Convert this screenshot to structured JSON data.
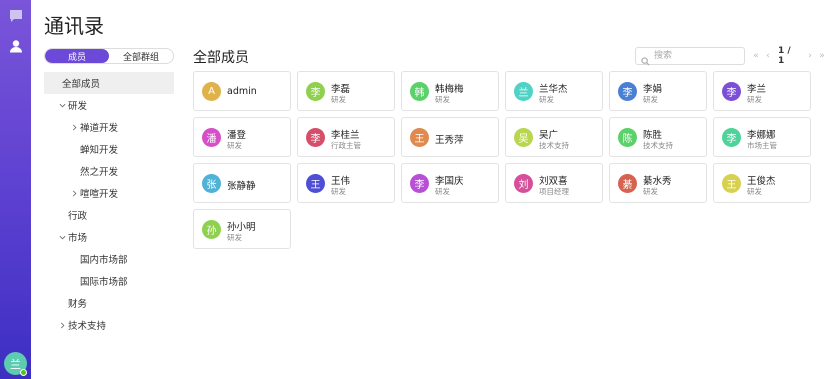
{
  "page": {
    "title": "通讯录"
  },
  "tabs": [
    {
      "label": "成员",
      "active": true
    },
    {
      "label": "全部群组",
      "active": false
    }
  ],
  "tree": [
    {
      "label": "全部成员",
      "level": 0,
      "caret": "none",
      "selected": true
    },
    {
      "label": "研发",
      "level": 1,
      "caret": "down",
      "selected": false
    },
    {
      "label": "禅道开发",
      "level": 2,
      "caret": "right",
      "selected": false
    },
    {
      "label": "蝉知开发",
      "level": 2,
      "caret": "none",
      "selected": false
    },
    {
      "label": "然之开发",
      "level": 2,
      "caret": "none",
      "selected": false
    },
    {
      "label": "喧喧开发",
      "level": 2,
      "caret": "right",
      "selected": false
    },
    {
      "label": "行政",
      "level": 1,
      "caret": "none",
      "selected": false
    },
    {
      "label": "市场",
      "level": 1,
      "caret": "down",
      "selected": false
    },
    {
      "label": "国内市场部",
      "level": 2,
      "caret": "none",
      "selected": false
    },
    {
      "label": "国际市场部",
      "level": 2,
      "caret": "none",
      "selected": false
    },
    {
      "label": "财务",
      "level": 1,
      "caret": "none",
      "selected": false
    },
    {
      "label": "技术支持",
      "level": 1,
      "caret": "right",
      "selected": false
    }
  ],
  "main": {
    "title": "全部成员",
    "search": {
      "placeholder": "搜索",
      "value": ""
    },
    "pager": {
      "text": "1 / 1"
    }
  },
  "members": [
    {
      "avatar": "A",
      "name": "admin",
      "role": "",
      "color": "#e0b34a"
    },
    {
      "avatar": "李",
      "name": "李磊",
      "role": "研发",
      "color": "#8fd14f"
    },
    {
      "avatar": "韩",
      "name": "韩梅梅",
      "role": "研发",
      "color": "#5bd16a"
    },
    {
      "avatar": "兰",
      "name": "兰华杰",
      "role": "研发",
      "color": "#4fd3c4"
    },
    {
      "avatar": "李",
      "name": "李娟",
      "role": "研发",
      "color": "#4a7fd6"
    },
    {
      "avatar": "李",
      "name": "李兰",
      "role": "研发",
      "color": "#7b4fd6"
    },
    {
      "avatar": "潘",
      "name": "潘登",
      "role": "研发",
      "color": "#d64fc8"
    },
    {
      "avatar": "李",
      "name": "李桂兰",
      "role": "行政主管",
      "color": "#d64f6a"
    },
    {
      "avatar": "王",
      "name": "王秀萍",
      "role": "",
      "color": "#e08a4f"
    },
    {
      "avatar": "吴",
      "name": "吴广",
      "role": "技术支持",
      "color": "#b8d64f"
    },
    {
      "avatar": "陈",
      "name": "陈胜",
      "role": "技术支持",
      "color": "#5bd16a"
    },
    {
      "avatar": "李",
      "name": "李娜娜",
      "role": "市场主管",
      "color": "#4fd39b"
    },
    {
      "avatar": "张",
      "name": "张静静",
      "role": "",
      "color": "#4fb2d6"
    },
    {
      "avatar": "王",
      "name": "王伟",
      "role": "研发",
      "color": "#4f4fd6"
    },
    {
      "avatar": "李",
      "name": "李国庆",
      "role": "研发",
      "color": "#b84fd6"
    },
    {
      "avatar": "刘",
      "name": "刘双喜",
      "role": "项目经理",
      "color": "#d64f9b"
    },
    {
      "avatar": "綦",
      "name": "綦水秀",
      "role": "研发",
      "color": "#d6624f"
    },
    {
      "avatar": "王",
      "name": "王俊杰",
      "role": "研发",
      "color": "#d6d14f"
    },
    {
      "avatar": "孙",
      "name": "孙小明",
      "role": "研发",
      "color": "#8fd14f"
    }
  ],
  "icons": {
    "rail_top": "chat-icon",
    "rail_second": "contacts-icon",
    "search": "search-icon"
  },
  "user": {
    "avatar": "兰",
    "status_color": "#52c41a"
  },
  "colors": {
    "accent": "#6c49d8",
    "rail_top": "#7a55d9",
    "rail_bottom": "#3c2fc2"
  }
}
